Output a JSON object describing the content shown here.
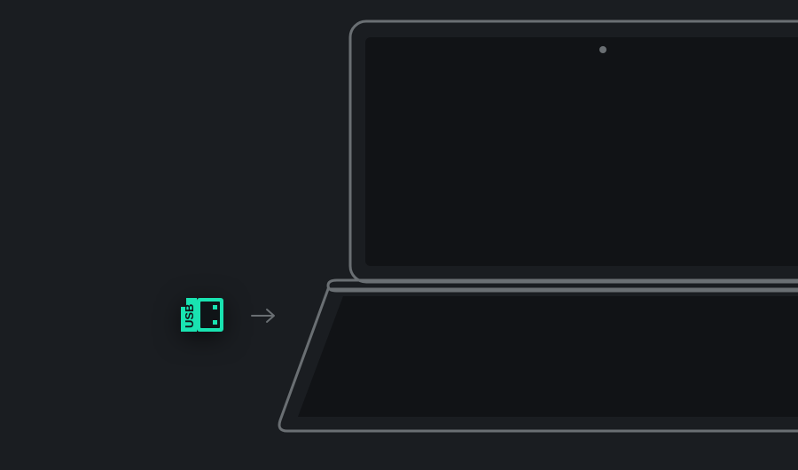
{
  "colors": {
    "background": "#1a1d21",
    "outline": "#6a6f73",
    "outline_dark": "#4a4e52",
    "accent": "#19e3b1",
    "panel": "#111316"
  },
  "usb": {
    "label": "USB"
  }
}
